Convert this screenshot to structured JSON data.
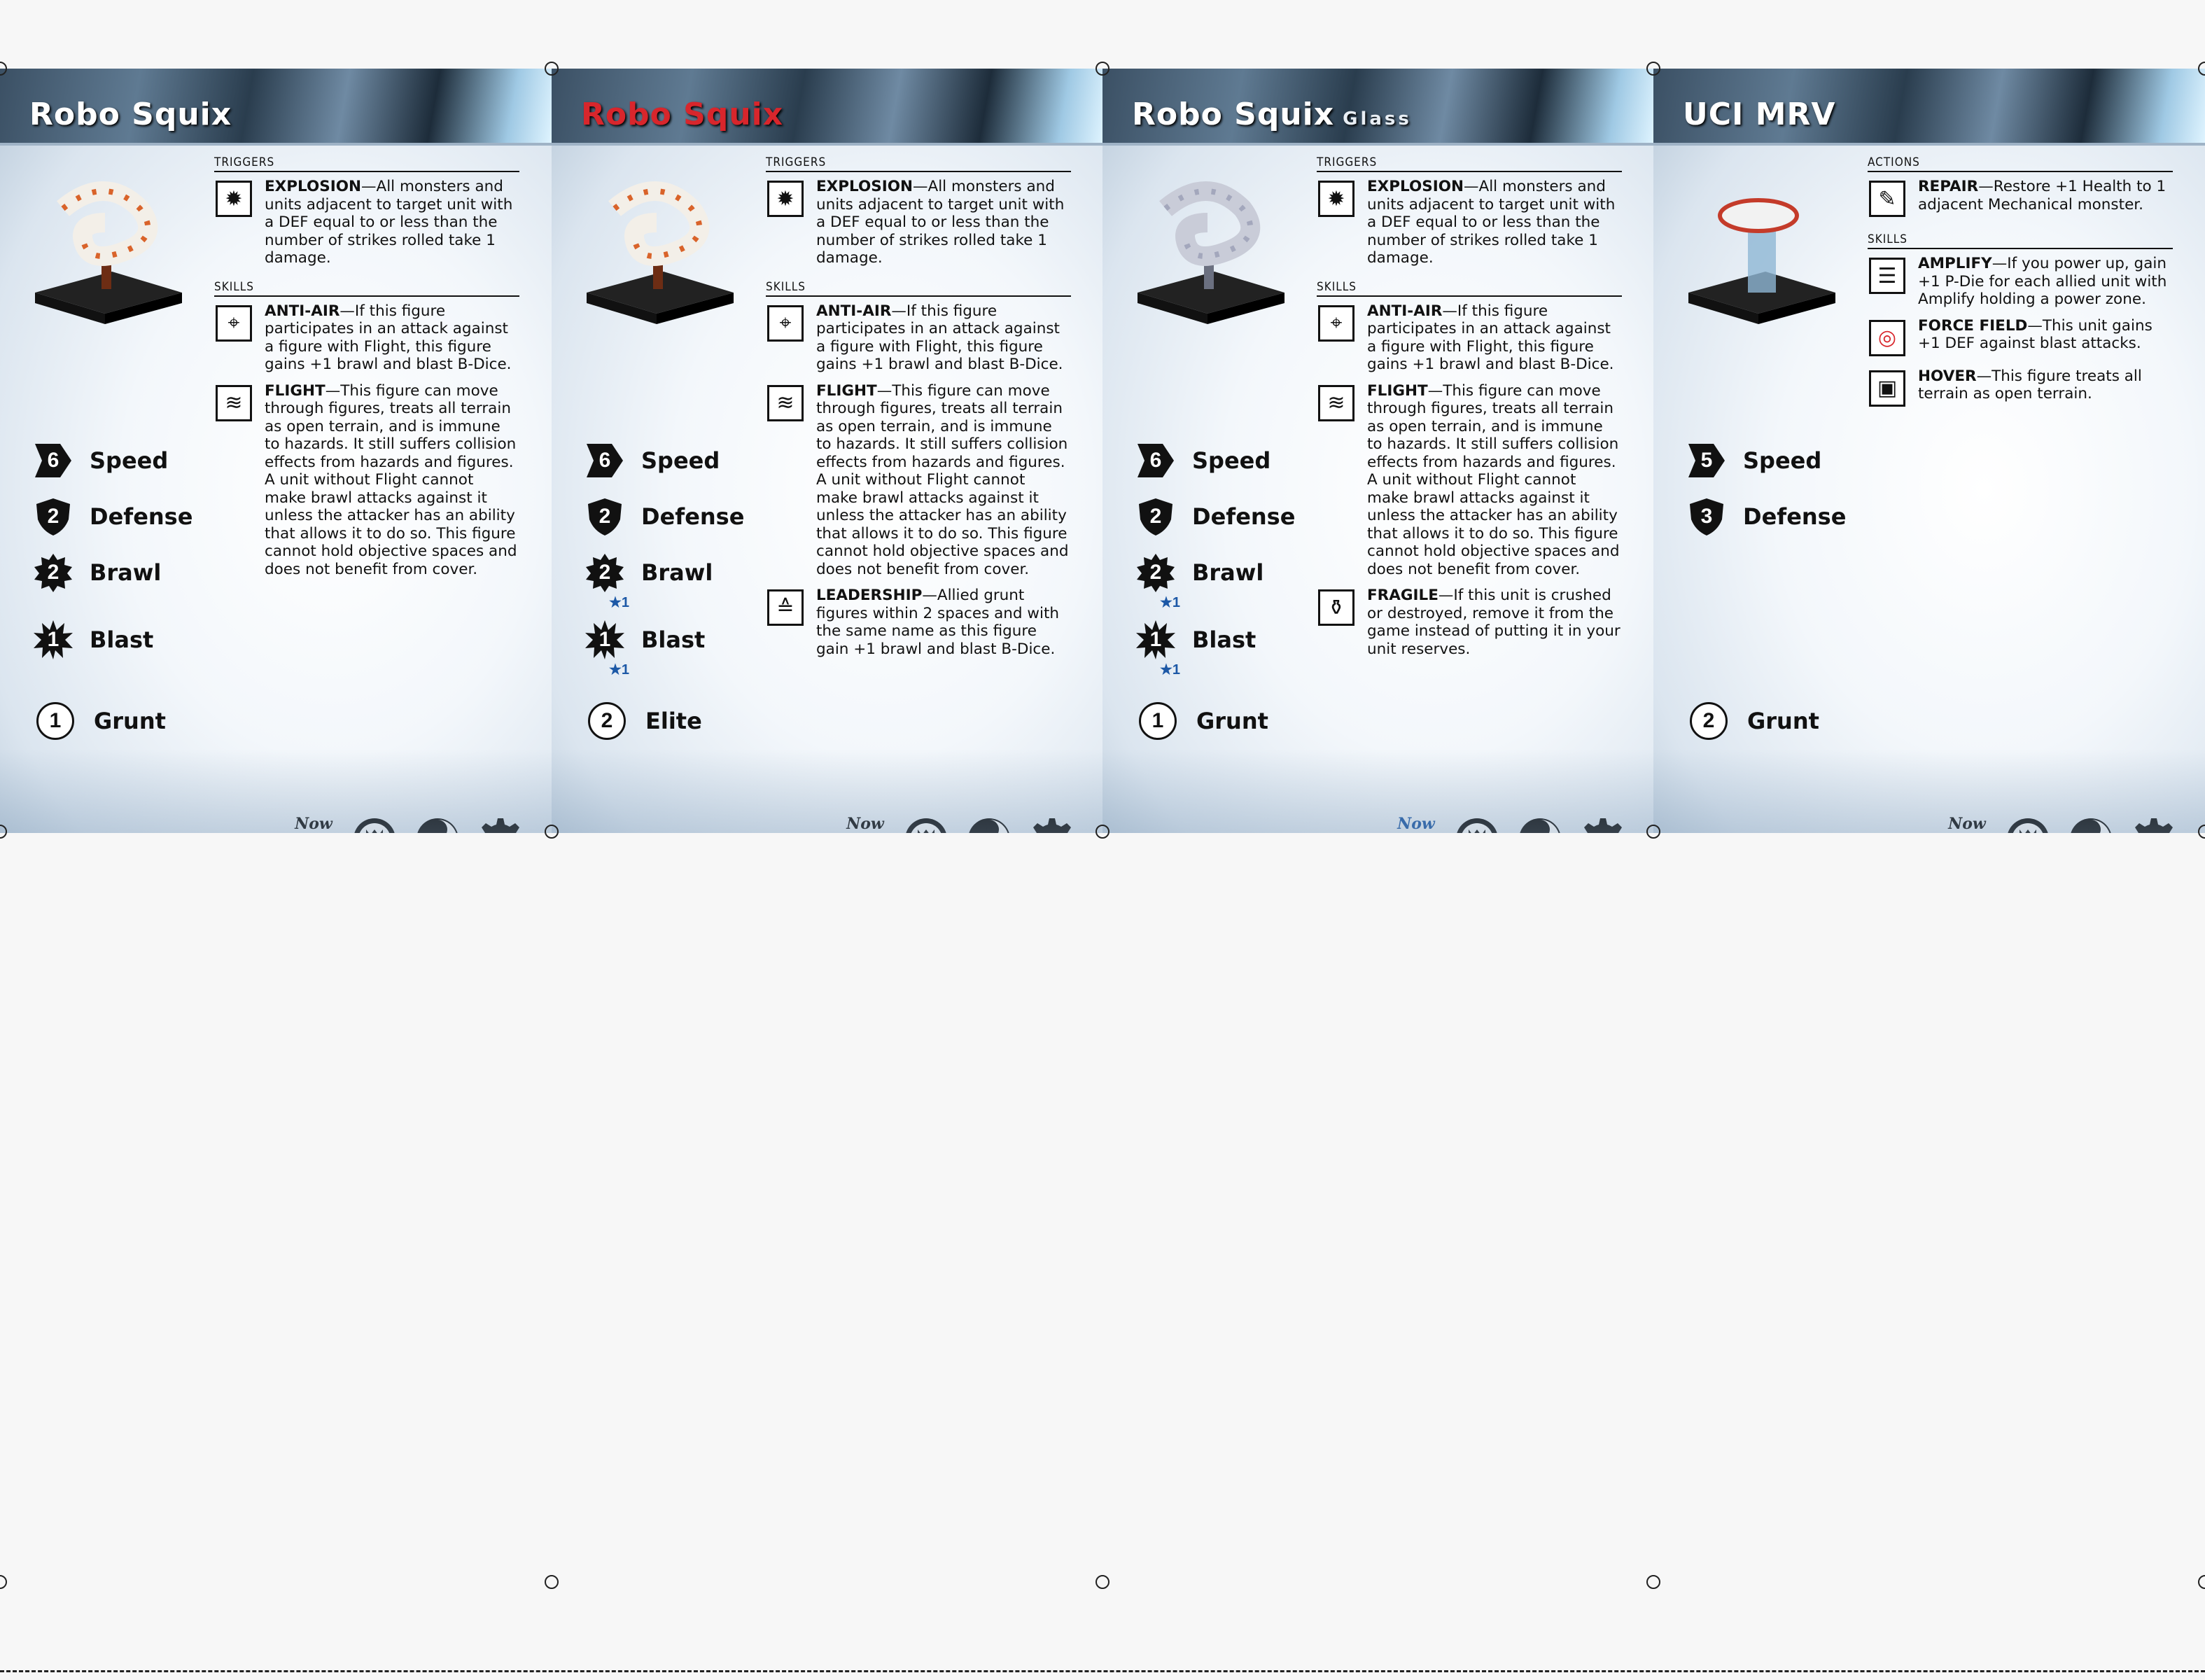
{
  "cards": [
    {
      "title": "Robo Squix",
      "title_variant": "",
      "title_color": "#ffffff",
      "stats": {
        "speed_value": "6",
        "speed_label": "Speed",
        "defense_value": "2",
        "defense_label": "Defense",
        "brawl_value": "2",
        "brawl_label": "Brawl",
        "brawl_bonus": "",
        "blast_value": "1",
        "blast_label": "Blast",
        "blast_bonus": "",
        "rank_value": "1",
        "rank_label": "Grunt"
      },
      "sections": [
        {
          "heading": "TRIGGERS",
          "abilities": [
            {
              "icon": "explosion-icon",
              "name": "EXPLOSION",
              "text": "—All monsters and units adjacent to target unit with a DEF equal to or less than the number of strikes rolled take 1 damage."
            }
          ]
        },
        {
          "heading": "SKILLS",
          "abilities": [
            {
              "icon": "anti-air-icon",
              "name": "ANTI-AIR",
              "text": "—If this figure participates in an attack against a figure with Flight, this figure gains +1 brawl and blast B-Dice."
            },
            {
              "icon": "flight-icon",
              "name": "FLIGHT",
              "text": "—This figure can move through figures, treats all terrain as open terrain, and is immune to hazards. It still suffers collision effects from hazards and figures. A unit without Flight cannot make brawl attacks against it unless the attacker has an ability that allows it to do so. This figure cannot hold objective spaces and does not benefit from cover."
            }
          ]
        }
      ],
      "now_stars": "★"
    },
    {
      "title": "Robo Squix",
      "title_variant": "",
      "title_color": "#d8262c",
      "stats": {
        "speed_value": "6",
        "speed_label": "Speed",
        "defense_value": "2",
        "defense_label": "Defense",
        "brawl_value": "2",
        "brawl_label": "Brawl",
        "brawl_bonus": "★1",
        "blast_value": "1",
        "blast_label": "Blast",
        "blast_bonus": "★1",
        "rank_value": "2",
        "rank_label": "Elite"
      },
      "sections": [
        {
          "heading": "TRIGGERS",
          "abilities": [
            {
              "icon": "explosion-icon",
              "name": "EXPLOSION",
              "text": "—All monsters and units adjacent to target unit with a DEF equal to or less than the number of strikes rolled take 1 damage."
            }
          ]
        },
        {
          "heading": "SKILLS",
          "abilities": [
            {
              "icon": "anti-air-icon",
              "name": "ANTI-AIR",
              "text": "—If this figure participates in an attack against a figure with Flight, this figure gains +1 brawl and blast B-Dice."
            },
            {
              "icon": "flight-icon",
              "name": "FLIGHT",
              "text": "—This figure can move through figures, treats all terrain as open terrain, and is immune to hazards. It still suffers collision effects from hazards and figures. A unit without Flight cannot make brawl attacks against it unless the attacker has an ability that allows it to do so. This figure cannot hold objective spaces and does not benefit from cover."
            },
            {
              "icon": "leadership-icon",
              "name": "LEADERSHIP",
              "text": "—Allied grunt figures within 2 spaces and with the same name as this figure gain +1 brawl and blast B-Dice."
            }
          ]
        }
      ],
      "now_stars": "★★★"
    },
    {
      "title": "Robo Squix",
      "title_variant": "Glass",
      "title_color": "#ffffff",
      "stats": {
        "speed_value": "6",
        "speed_label": "Speed",
        "defense_value": "2",
        "defense_label": "Defense",
        "brawl_value": "2",
        "brawl_label": "Brawl",
        "brawl_bonus": "★1",
        "blast_value": "1",
        "blast_label": "Blast",
        "blast_bonus": "★1",
        "rank_value": "1",
        "rank_label": "Grunt"
      },
      "sections": [
        {
          "heading": "TRIGGERS",
          "abilities": [
            {
              "icon": "explosion-icon",
              "name": "EXPLOSION",
              "text": "—All monsters and units adjacent to target unit with a DEF equal to or less than the number of strikes rolled take 1 damage."
            }
          ]
        },
        {
          "heading": "SKILLS",
          "abilities": [
            {
              "icon": "anti-air-icon",
              "name": "ANTI-AIR",
              "text": "—If this figure participates in an attack against a figure with Flight, this figure gains +1 brawl and blast B-Dice."
            },
            {
              "icon": "flight-icon",
              "name": "FLIGHT",
              "text": "—This figure can move through figures, treats all terrain as open terrain, and is immune to hazards. It still suffers collision effects from hazards and figures. A unit without Flight cannot make brawl attacks against it unless the attacker has an ability that allows it to do so. This figure cannot hold objective spaces and does not benefit from cover."
            },
            {
              "icon": "fragile-icon",
              "name": "FRAGILE",
              "text": "—If this unit is crushed or destroyed, remove it from the game instead of putting it in your unit reserves."
            }
          ]
        }
      ],
      "now_stars": "★★★★"
    },
    {
      "title": "UCI MRV",
      "title_variant": "",
      "title_color": "#ffffff",
      "stats": {
        "speed_value": "5",
        "speed_label": "Speed",
        "defense_value": "3",
        "defense_label": "Defense",
        "brawl_value": "",
        "brawl_label": "",
        "brawl_bonus": "",
        "blast_value": "",
        "blast_label": "",
        "blast_bonus": "",
        "rank_value": "2",
        "rank_label": "Grunt"
      },
      "sections": [
        {
          "heading": "ACTIONS",
          "abilities": [
            {
              "icon": "repair-icon",
              "name": "REPAIR",
              "text": "—Restore +1 Health to 1 adjacent Mechanical monster."
            }
          ]
        },
        {
          "heading": "SKILLS",
          "abilities": [
            {
              "icon": "amplify-icon",
              "name": "AMPLIFY",
              "text": "—If you power up, gain +1 P-Die for each allied unit with Amplify holding a power zone."
            },
            {
              "icon": "force-field-icon",
              "name": "FORCE FIELD",
              "text": "—This unit gains +1 DEF against blast attacks."
            },
            {
              "icon": "hover-icon",
              "name": "HOVER",
              "text": "—This figure treats all terrain as open terrain."
            }
          ]
        }
      ],
      "now_stars": "★★"
    }
  ],
  "footer": {
    "now_label": "Now",
    "icons": [
      "monster-faction-icon",
      "yin-yang-icon",
      "gear-icon"
    ]
  }
}
